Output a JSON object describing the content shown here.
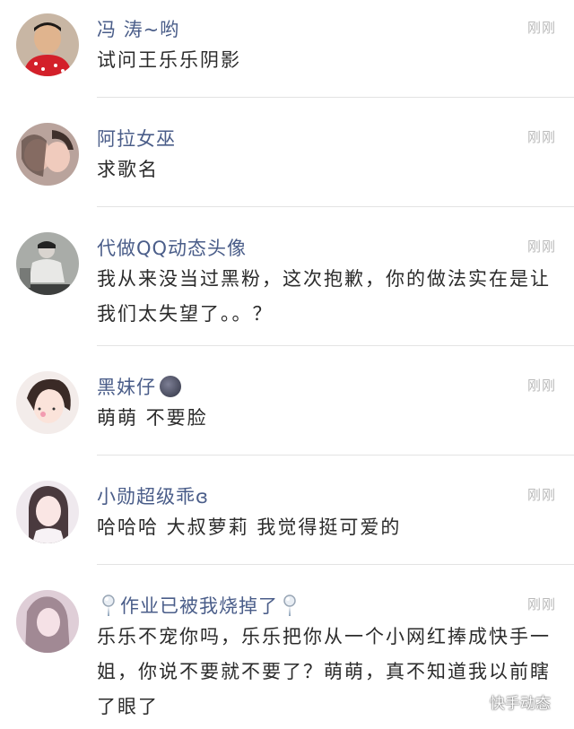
{
  "comments": [
    {
      "user": "冯  涛~哟",
      "time": "刚刚",
      "text": "试问王乐乐阴影",
      "avatar": "avatar-boy-red-scarf"
    },
    {
      "user": "阿拉女巫",
      "time": "刚刚",
      "text": "求歌名",
      "avatar": "avatar-couple"
    },
    {
      "user": "代做QQ动态头像",
      "time": "刚刚",
      "text": "我从来没当过黑粉，这次抱歉，你的做法实在是让我们太失望了。。？",
      "avatar": "avatar-man-sitting"
    },
    {
      "user": "黑妹仔",
      "time": "刚刚",
      "text": "萌萌 不要脸",
      "avatar": "avatar-girl-cat-ears"
    },
    {
      "user": "小勋超级乖ɞ",
      "time": "刚刚",
      "text": "哈哈哈  大叔萝莉  我觉得挺可爱的",
      "avatar": "avatar-girl-hair"
    },
    {
      "user": "作业已被我烧掉了",
      "time": "刚刚",
      "text": "乐乐不宠你吗，乐乐把你从一个小网红捧成快手一姐，你说不要就不要了？萌萌，真不知道我以前瞎了眼了",
      "avatar": "avatar-girl-pink"
    }
  ],
  "watermark": {
    "label": "快手动态",
    "icon": "wechat-icon"
  }
}
